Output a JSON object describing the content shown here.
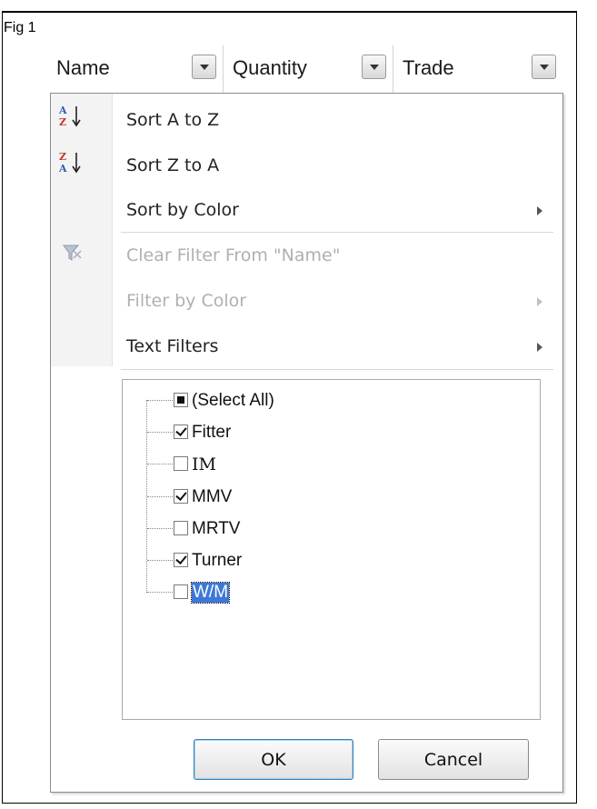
{
  "figure": {
    "label": "Fig 1"
  },
  "columns": [
    {
      "label": "Name"
    },
    {
      "label": "Quantity"
    },
    {
      "label": "Trade"
    }
  ],
  "menu": {
    "sort_az": "Sort A to Z",
    "sort_za": "Sort Z to A",
    "sort_color": "Sort by Color",
    "clear_filter": "Clear Filter From \"Name\"",
    "filter_color": "Filter by Color",
    "text_filters": "Text Filters"
  },
  "list": {
    "items": [
      {
        "label": "(Select All)",
        "state": "partial"
      },
      {
        "label": "Fitter",
        "state": "checked"
      },
      {
        "label": "IM",
        "state": "unchecked"
      },
      {
        "label": "MMV",
        "state": "checked"
      },
      {
        "label": "MRTV",
        "state": "unchecked"
      },
      {
        "label": "Turner",
        "state": "checked"
      },
      {
        "label": "W/M",
        "state": "unchecked",
        "focused": true
      }
    ]
  },
  "buttons": {
    "ok": "OK",
    "cancel": "Cancel"
  },
  "icons": {
    "sort_az": "sort-ascending-icon",
    "sort_za": "sort-descending-icon",
    "clear_filter": "clear-filter-icon"
  }
}
